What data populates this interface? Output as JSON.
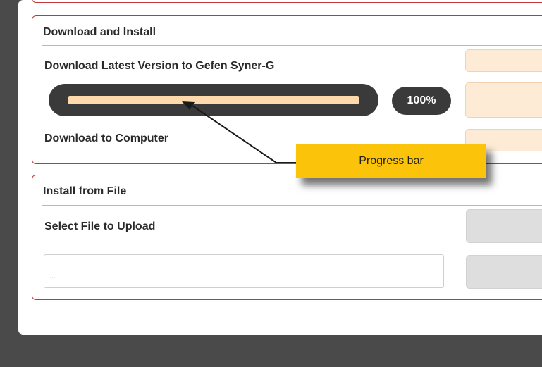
{
  "download_section": {
    "title": "Download and Install",
    "latest_label": "Download Latest Version to Gefen Syner-G",
    "progress": {
      "fraction": 1.0,
      "percent_label": "100%"
    },
    "computer_label": "Download to Computer"
  },
  "install_section": {
    "title": "Install from File",
    "select_label": "Select File to Upload",
    "file_input_value": "..."
  },
  "annotation": {
    "callout_text": "Progress bar"
  },
  "colors": {
    "section_border": "#c0383a",
    "progress_fill": "#fdd9ab",
    "callout": "#fbc40b",
    "background": "#4a4a4a"
  }
}
